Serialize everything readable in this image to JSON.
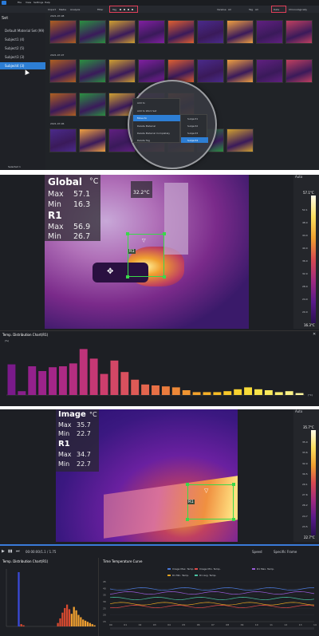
{
  "panel1": {
    "menu": [
      "File",
      "View",
      "Settings",
      "Help"
    ],
    "toolbar": [
      "Import",
      "Media",
      "Analysis",
      "Filter",
      "Tag",
      "Varwise",
      "All",
      "Tag",
      "All",
      "Date",
      "Chronologically"
    ],
    "sidebar": {
      "header": "Set",
      "items": [
        "Default Material Set (99)",
        "Subject1 (4)",
        "Subject2 (5)",
        "Subject3 (3)",
        "Subject4 (3)"
      ],
      "selected_index": 4
    },
    "date_groups": [
      "2021-07-08",
      "2021-07-07",
      "2021-07-06"
    ],
    "context_menu": [
      "Add to",
      "Add to Work Set",
      "Move to",
      "Delete Material",
      "Delete Material Completely",
      "Delete Tag"
    ],
    "submenu": [
      "Subject1",
      "Subject2",
      "Subject3",
      "Subject4"
    ],
    "status": "Selected 1",
    "thumb_colors": [
      "#b06020",
      "#2a9040",
      "#d0a030",
      "#8020a0",
      "#e06030",
      "#4a2a8a",
      "#f0a040",
      "#602080",
      "#c04060"
    ]
  },
  "panel2": {
    "overlay": {
      "title1": "Global",
      "unit": "°C",
      "max_label": "Max",
      "max_val": "57.1",
      "min_label": "Min",
      "min_val": "16.3",
      "title2": "R1",
      "r1_max_val": "56.9",
      "r1_min_val": "26.7"
    },
    "cursor_temp": "32.2°C",
    "region_label": "R1",
    "scale": {
      "auto": "Auto",
      "top": "57.1°C",
      "bottom": "16.3°C",
      "ticks": [
        "52.1",
        "48.0",
        "44.0",
        "40.0",
        "36.0",
        "32.0",
        "28.0",
        "24.0",
        "20.0"
      ]
    },
    "chart_title": "Temp. Distribution Chart(R1)",
    "ylabel": "(%)",
    "xlabel": "(°C)"
  },
  "panel3": {
    "overlay": {
      "title1": "Image",
      "unit": "°C",
      "max_label": "Max",
      "max_val": "35.7",
      "min_label": "Min",
      "min_val": "22.7",
      "title2": "R1",
      "r1_max_val": "34.7",
      "r1_min_val": "22.7"
    },
    "region_label": "R1",
    "scale": {
      "auto": "Auto",
      "top": "35.7°C",
      "bottom": "22.7°C",
      "ticks": [
        "35.0",
        "33.6",
        "32.0",
        "30.5",
        "29.1",
        "27.6",
        "26.2",
        "24.7",
        "23.5"
      ]
    },
    "playback": {
      "time": "00:00:00/1.1 / 1.75",
      "speed": "Speed",
      "frame": "Specific Frame"
    },
    "dist_title": "Temp. Distribution Chart(R1)",
    "curve_title": "Time Temperature Curve",
    "legend": [
      "Image Max. Temp.",
      "Image Min. Temp.",
      "R1 Max. Temp.",
      "R1 Min. Temp.",
      "R1 Avg. Temp."
    ],
    "legend_colors": [
      "#4a78d8",
      "#e04a4a",
      "#9a5ad8",
      "#e0a020",
      "#4ac0a0"
    ],
    "curve_y_ticks": [
      "45",
      "40",
      "35",
      "30",
      "25",
      "20",
      "15"
    ],
    "curve_x_ticks": [
      "00",
      "01",
      "02",
      "03",
      "04",
      "05",
      "06",
      "07",
      "08",
      "09",
      "10",
      "11",
      "12",
      "13",
      "14"
    ]
  },
  "chart_data": [
    {
      "type": "bar",
      "title": "Temp. Distribution Chart(R1)",
      "ylabel": "(%)",
      "xlabel": "(°C)",
      "values": [
        3.2,
        0.4,
        3.0,
        2.5,
        2.9,
        3.0,
        3.3,
        4.8,
        3.8,
        2.2,
        3.6,
        2.4,
        1.6,
        1.1,
        1.0,
        0.9,
        0.8,
        0.5,
        0.3,
        0.3,
        0.3,
        0.4,
        0.6,
        0.8,
        0.6,
        0.5,
        0.3,
        0.4,
        0.2
      ],
      "colors": [
        "#7a1a8a",
        "#8a1f8c",
        "#94218c",
        "#9c238a",
        "#a42688",
        "#ad2a84",
        "#b52e80",
        "#be337a",
        "#c63874",
        "#cd3e6d",
        "#d34766",
        "#d9505e",
        "#de5a56",
        "#e3654e",
        "#e77046",
        "#ea7c3e",
        "#ed8838",
        "#f09532",
        "#f2a22c",
        "#f4af28",
        "#f6bc26",
        "#f7c82a",
        "#f8d230",
        "#f9dc3a",
        "#f9e44a",
        "#faea5c",
        "#faee70",
        "#fbf286",
        "#fbf59e"
      ],
      "ylim": [
        0,
        5.5
      ]
    },
    {
      "type": "bar",
      "title": "Temp. Distribution Chart(R1)",
      "values": [
        0,
        0,
        0,
        0,
        0,
        0.1,
        0.2,
        0.1,
        0,
        0,
        0,
        0,
        0,
        0,
        0,
        0,
        0,
        0,
        0,
        0,
        0,
        0,
        0.3,
        0.7,
        1.2,
        1.6,
        1.9,
        1.5,
        1.1,
        1.7,
        1.4,
        1.0,
        0.8,
        0.6,
        0.5,
        0.4,
        0.3,
        0.2,
        0.1
      ],
      "highlight_index": 5,
      "ylim": [
        0,
        5
      ]
    }
  ]
}
